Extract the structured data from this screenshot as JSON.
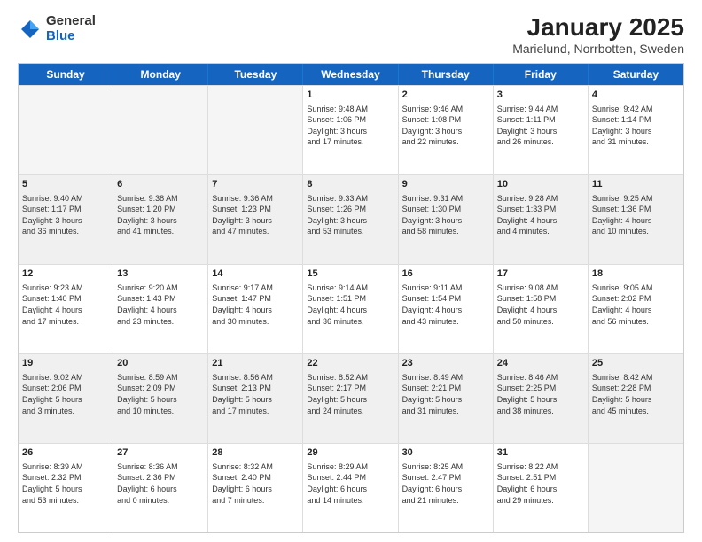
{
  "header": {
    "logo": {
      "general": "General",
      "blue": "Blue"
    },
    "title": "January 2025",
    "subtitle": "Marielund, Norrbotten, Sweden"
  },
  "days": [
    "Sunday",
    "Monday",
    "Tuesday",
    "Wednesday",
    "Thursday",
    "Friday",
    "Saturday"
  ],
  "rows": [
    [
      {
        "num": "",
        "lines": []
      },
      {
        "num": "",
        "lines": []
      },
      {
        "num": "",
        "lines": []
      },
      {
        "num": "1",
        "lines": [
          "Sunrise: 9:48 AM",
          "Sunset: 1:06 PM",
          "Daylight: 3 hours",
          "and 17 minutes."
        ]
      },
      {
        "num": "2",
        "lines": [
          "Sunrise: 9:46 AM",
          "Sunset: 1:08 PM",
          "Daylight: 3 hours",
          "and 22 minutes."
        ]
      },
      {
        "num": "3",
        "lines": [
          "Sunrise: 9:44 AM",
          "Sunset: 1:11 PM",
          "Daylight: 3 hours",
          "and 26 minutes."
        ]
      },
      {
        "num": "4",
        "lines": [
          "Sunrise: 9:42 AM",
          "Sunset: 1:14 PM",
          "Daylight: 3 hours",
          "and 31 minutes."
        ]
      }
    ],
    [
      {
        "num": "5",
        "lines": [
          "Sunrise: 9:40 AM",
          "Sunset: 1:17 PM",
          "Daylight: 3 hours",
          "and 36 minutes."
        ]
      },
      {
        "num": "6",
        "lines": [
          "Sunrise: 9:38 AM",
          "Sunset: 1:20 PM",
          "Daylight: 3 hours",
          "and 41 minutes."
        ]
      },
      {
        "num": "7",
        "lines": [
          "Sunrise: 9:36 AM",
          "Sunset: 1:23 PM",
          "Daylight: 3 hours",
          "and 47 minutes."
        ]
      },
      {
        "num": "8",
        "lines": [
          "Sunrise: 9:33 AM",
          "Sunset: 1:26 PM",
          "Daylight: 3 hours",
          "and 53 minutes."
        ]
      },
      {
        "num": "9",
        "lines": [
          "Sunrise: 9:31 AM",
          "Sunset: 1:30 PM",
          "Daylight: 3 hours",
          "and 58 minutes."
        ]
      },
      {
        "num": "10",
        "lines": [
          "Sunrise: 9:28 AM",
          "Sunset: 1:33 PM",
          "Daylight: 4 hours",
          "and 4 minutes."
        ]
      },
      {
        "num": "11",
        "lines": [
          "Sunrise: 9:25 AM",
          "Sunset: 1:36 PM",
          "Daylight: 4 hours",
          "and 10 minutes."
        ]
      }
    ],
    [
      {
        "num": "12",
        "lines": [
          "Sunrise: 9:23 AM",
          "Sunset: 1:40 PM",
          "Daylight: 4 hours",
          "and 17 minutes."
        ]
      },
      {
        "num": "13",
        "lines": [
          "Sunrise: 9:20 AM",
          "Sunset: 1:43 PM",
          "Daylight: 4 hours",
          "and 23 minutes."
        ]
      },
      {
        "num": "14",
        "lines": [
          "Sunrise: 9:17 AM",
          "Sunset: 1:47 PM",
          "Daylight: 4 hours",
          "and 30 minutes."
        ]
      },
      {
        "num": "15",
        "lines": [
          "Sunrise: 9:14 AM",
          "Sunset: 1:51 PM",
          "Daylight: 4 hours",
          "and 36 minutes."
        ]
      },
      {
        "num": "16",
        "lines": [
          "Sunrise: 9:11 AM",
          "Sunset: 1:54 PM",
          "Daylight: 4 hours",
          "and 43 minutes."
        ]
      },
      {
        "num": "17",
        "lines": [
          "Sunrise: 9:08 AM",
          "Sunset: 1:58 PM",
          "Daylight: 4 hours",
          "and 50 minutes."
        ]
      },
      {
        "num": "18",
        "lines": [
          "Sunrise: 9:05 AM",
          "Sunset: 2:02 PM",
          "Daylight: 4 hours",
          "and 56 minutes."
        ]
      }
    ],
    [
      {
        "num": "19",
        "lines": [
          "Sunrise: 9:02 AM",
          "Sunset: 2:06 PM",
          "Daylight: 5 hours",
          "and 3 minutes."
        ]
      },
      {
        "num": "20",
        "lines": [
          "Sunrise: 8:59 AM",
          "Sunset: 2:09 PM",
          "Daylight: 5 hours",
          "and 10 minutes."
        ]
      },
      {
        "num": "21",
        "lines": [
          "Sunrise: 8:56 AM",
          "Sunset: 2:13 PM",
          "Daylight: 5 hours",
          "and 17 minutes."
        ]
      },
      {
        "num": "22",
        "lines": [
          "Sunrise: 8:52 AM",
          "Sunset: 2:17 PM",
          "Daylight: 5 hours",
          "and 24 minutes."
        ]
      },
      {
        "num": "23",
        "lines": [
          "Sunrise: 8:49 AM",
          "Sunset: 2:21 PM",
          "Daylight: 5 hours",
          "and 31 minutes."
        ]
      },
      {
        "num": "24",
        "lines": [
          "Sunrise: 8:46 AM",
          "Sunset: 2:25 PM",
          "Daylight: 5 hours",
          "and 38 minutes."
        ]
      },
      {
        "num": "25",
        "lines": [
          "Sunrise: 8:42 AM",
          "Sunset: 2:28 PM",
          "Daylight: 5 hours",
          "and 45 minutes."
        ]
      }
    ],
    [
      {
        "num": "26",
        "lines": [
          "Sunrise: 8:39 AM",
          "Sunset: 2:32 PM",
          "Daylight: 5 hours",
          "and 53 minutes."
        ]
      },
      {
        "num": "27",
        "lines": [
          "Sunrise: 8:36 AM",
          "Sunset: 2:36 PM",
          "Daylight: 6 hours",
          "and 0 minutes."
        ]
      },
      {
        "num": "28",
        "lines": [
          "Sunrise: 8:32 AM",
          "Sunset: 2:40 PM",
          "Daylight: 6 hours",
          "and 7 minutes."
        ]
      },
      {
        "num": "29",
        "lines": [
          "Sunrise: 8:29 AM",
          "Sunset: 2:44 PM",
          "Daylight: 6 hours",
          "and 14 minutes."
        ]
      },
      {
        "num": "30",
        "lines": [
          "Sunrise: 8:25 AM",
          "Sunset: 2:47 PM",
          "Daylight: 6 hours",
          "and 21 minutes."
        ]
      },
      {
        "num": "31",
        "lines": [
          "Sunrise: 8:22 AM",
          "Sunset: 2:51 PM",
          "Daylight: 6 hours",
          "and 29 minutes."
        ]
      },
      {
        "num": "",
        "lines": []
      }
    ]
  ]
}
